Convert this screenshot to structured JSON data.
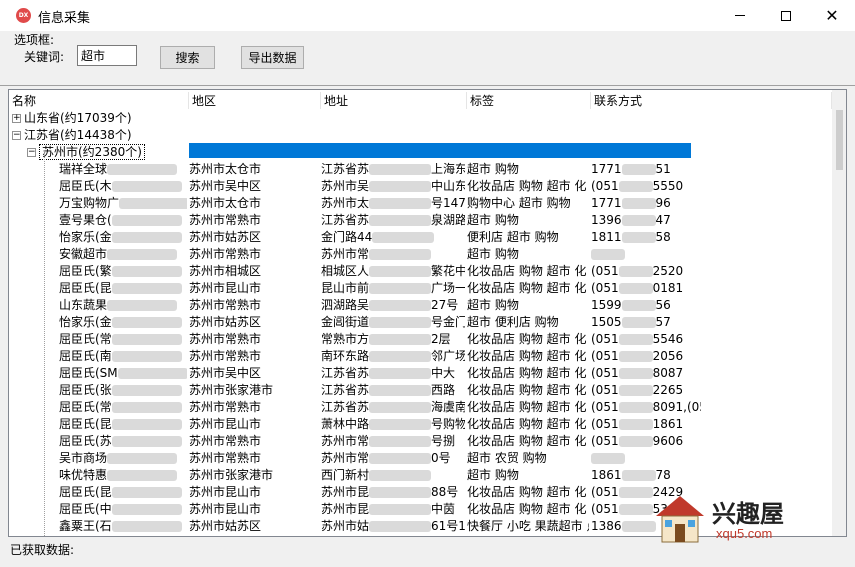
{
  "window": {
    "title": "信息采集",
    "app_icon_text": "DX"
  },
  "group_label": "选项框:",
  "keyword": {
    "label": "关键词:",
    "value": "超市"
  },
  "buttons": {
    "search": "搜索",
    "export": "导出数据"
  },
  "columns": [
    "名称",
    "地区",
    "地址",
    "标签",
    "联系方式"
  ],
  "tree": {
    "shandong": "山东省(约17039个)",
    "jiangsu": "江苏省(约14438个)",
    "suzhou": "苏州市(约2380个)"
  },
  "rows": [
    {
      "name": "瑞祥全球",
      "region": "苏州市太仓市",
      "addr": "江苏省苏",
      "addr2": "上海东",
      "tags": "超市 购物",
      "phone": "1771",
      "phone2": "51"
    },
    {
      "name": "屈臣氏(木",
      "region": "苏州市吴中区",
      "addr": "苏州市吴",
      "addr2": "中山东",
      "tags": "化妆品店 购物 超市 化",
      "phone": "(051",
      "phone2": "5550"
    },
    {
      "name": "万宝购物广",
      "region": "苏州市太仓市",
      "addr": "苏州市太",
      "addr2": "号147号",
      "tags": "购物中心 超市 购物",
      "phone": "1771",
      "phone2": "96"
    },
    {
      "name": "壹号果仓(",
      "region": "苏州市常熟市",
      "addr": "江苏省苏",
      "addr2": "泉湖路",
      "tags": "超市 购物",
      "phone": "1396",
      "phone2": "47"
    },
    {
      "name": "怡家乐(金",
      "region": "苏州市姑苏区",
      "addr": "金门路44",
      "addr2": "",
      "tags": "便利店 超市 购物",
      "phone": "1811",
      "phone2": "58"
    },
    {
      "name": "安徽超市",
      "region": "苏州市常熟市",
      "addr": "苏州市常",
      "addr2": "",
      "tags": "超市 购物",
      "phone": "",
      "phone2": ""
    },
    {
      "name": "屈臣氏(繁",
      "region": "苏州市相城区",
      "addr": "相城区人",
      "addr2": "繁花中",
      "tags": "化妆品店 购物 超市 化",
      "phone": "(051",
      "phone2": "2520"
    },
    {
      "name": "屈臣氏(昆",
      "region": "苏州市昆山市",
      "addr": "昆山市前",
      "addr2": "广场一",
      "tags": "化妆品店 购物 超市 化",
      "phone": "(051",
      "phone2": "0181"
    },
    {
      "name": "山东蔬果",
      "region": "苏州市常熟市",
      "addr": "泗湖路吴",
      "addr2": "27号",
      "tags": "超市 购物",
      "phone": "1599",
      "phone2": "56"
    },
    {
      "name": "怡家乐(金",
      "region": "苏州市姑苏区",
      "addr": "金阊街道",
      "addr2": "号金门",
      "tags": "超市 便利店 购物",
      "phone": "1505",
      "phone2": "57"
    },
    {
      "name": "屈臣氏(常",
      "region": "苏州市常熟市",
      "addr": "常熟市方",
      "addr2": "2层",
      "tags": "化妆品店 购物 超市 化",
      "phone": "(051",
      "phone2": "5546"
    },
    {
      "name": "屈臣氏(南",
      "region": "苏州市常熟市",
      "addr": "南环东路",
      "addr2": "邻广场",
      "tags": "化妆品店 购物 超市 化",
      "phone": "(051",
      "phone2": "2056"
    },
    {
      "name": "屈臣氏(SM",
      "region": "苏州市吴中区",
      "addr": "江苏省苏",
      "addr2": "中大",
      "tags": "化妆品店 购物 超市 化",
      "phone": "(051",
      "phone2": "8087"
    },
    {
      "name": "屈臣氏(张",
      "region": "苏州市张家港市",
      "addr": "江苏省苏",
      "addr2": "西路",
      "tags": "化妆品店 购物 超市 化",
      "phone": "(051",
      "phone2": "2265"
    },
    {
      "name": "屈臣氏(常",
      "region": "苏州市常熟市",
      "addr": "江苏省苏",
      "addr2": "海虞南",
      "tags": "化妆品店 购物 超市 化",
      "phone": "(051",
      "phone2": "8091,(05"
    },
    {
      "name": "屈臣氏(昆",
      "region": "苏州市昆山市",
      "addr": "萧林中路",
      "addr2": "号购物",
      "tags": "化妆品店 购物 超市 化",
      "phone": "(051",
      "phone2": "1861"
    },
    {
      "name": "屈臣氏(苏",
      "region": "苏州市常熟市",
      "addr": "苏州市常",
      "addr2": "号捌",
      "tags": "化妆品店 购物 超市 化",
      "phone": "(051",
      "phone2": "9606"
    },
    {
      "name": "吴市商场",
      "region": "苏州市常熟市",
      "addr": "苏州市常",
      "addr2": "0号",
      "tags": "超市 农贸 购物",
      "phone": "",
      "phone2": ""
    },
    {
      "name": "味优特惠",
      "region": "苏州市张家港市",
      "addr": "西门新村",
      "addr2": "",
      "tags": "超市 购物",
      "phone": "1861",
      "phone2": "78"
    },
    {
      "name": "屈臣氏(昆",
      "region": "苏州市昆山市",
      "addr": "苏州市昆",
      "addr2": "88号",
      "tags": "化妆品店 购物 超市 化",
      "phone": "(051",
      "phone2": "2429"
    },
    {
      "name": "屈臣氏(中",
      "region": "苏州市昆山市",
      "addr": "苏州市昆",
      "addr2": "中茵",
      "tags": "化妆品店 购物 超市 化",
      "phone": "(051",
      "phone2": "53"
    },
    {
      "name": "鑫粟王(石",
      "region": "苏州市姑苏区",
      "addr": "苏州市姑",
      "addr2": "61号1",
      "tags": "快餐厅 小吃 果蔬超市 点",
      "phone": "1386",
      "phone2": ""
    }
  ],
  "status_label": "已获取数据:",
  "watermark": {
    "title": "兴趣屋",
    "url": "xqu5.com"
  },
  "colors": {
    "selection": "#0078d7",
    "window_bg": "#f0f0f0",
    "watermark_red": "#c0392b"
  }
}
